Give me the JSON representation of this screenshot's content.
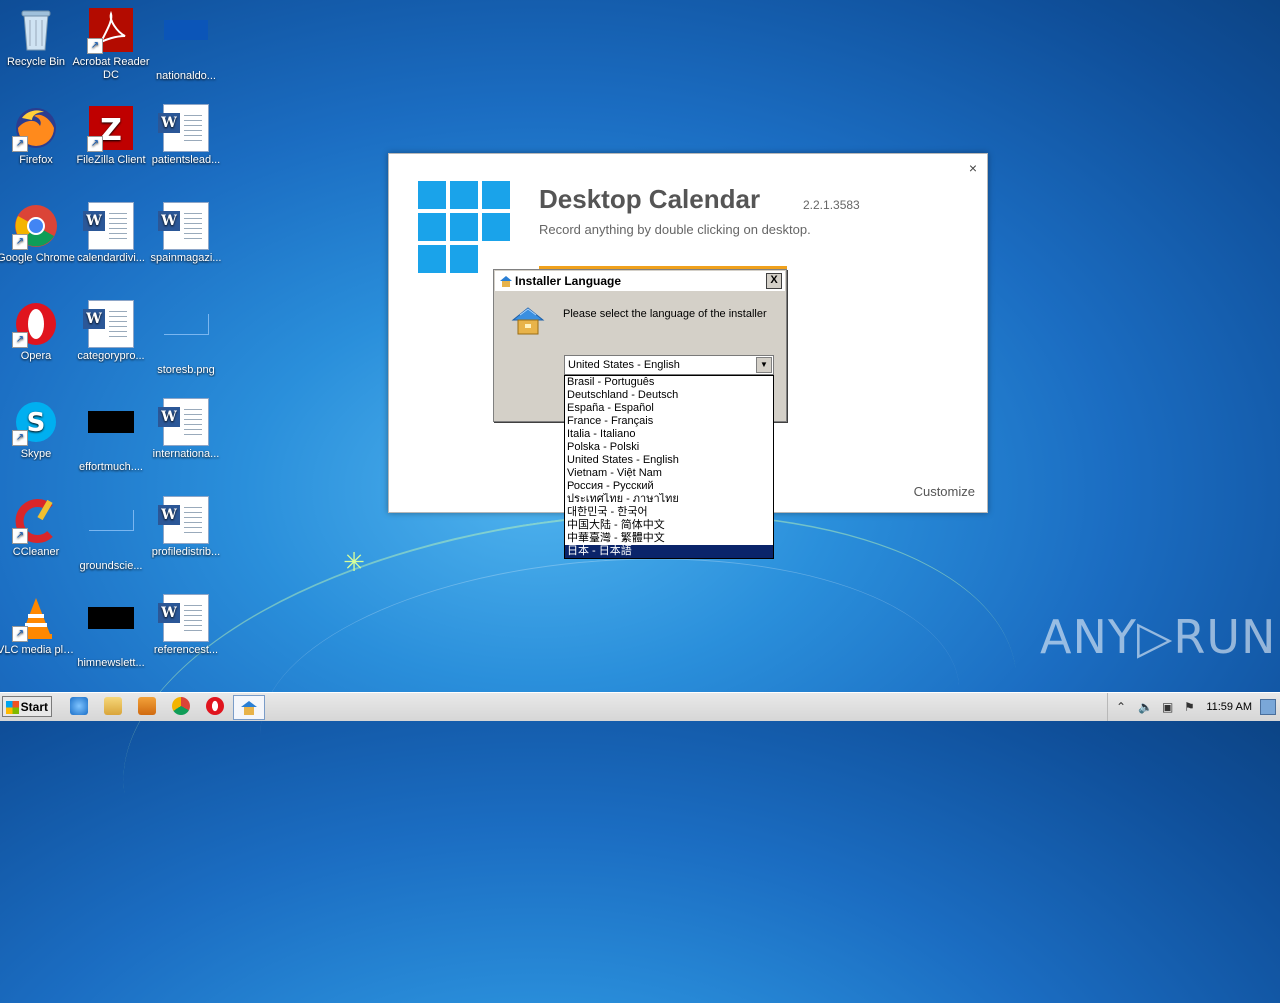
{
  "desktop": {
    "icons": [
      {
        "label": "Recycle Bin",
        "icon": "recycle-bin-icon"
      },
      {
        "label": "Acrobat Reader DC",
        "icon": "acrobat-icon"
      },
      {
        "label": "nationaldo...",
        "icon": "file-icon"
      },
      {
        "label": "Firefox",
        "icon": "firefox-icon"
      },
      {
        "label": "FileZilla Client",
        "icon": "filezilla-icon"
      },
      {
        "label": "patientslead...",
        "icon": "word-doc-icon"
      },
      {
        "label": "Google Chrome",
        "icon": "chrome-icon"
      },
      {
        "label": "calendardivi...",
        "icon": "word-doc-icon"
      },
      {
        "label": "spainmagazi...",
        "icon": "word-doc-icon"
      },
      {
        "label": "Opera",
        "icon": "opera-icon"
      },
      {
        "label": "categorypro...",
        "icon": "word-doc-icon"
      },
      {
        "label": "storesb.png",
        "icon": "image-file-icon"
      },
      {
        "label": "Skype",
        "icon": "skype-icon"
      },
      {
        "label": "effortmuch....",
        "icon": "file-icon"
      },
      {
        "label": "internationa...",
        "icon": "word-doc-icon"
      },
      {
        "label": "CCleaner",
        "icon": "ccleaner-icon"
      },
      {
        "label": "groundscie...",
        "icon": "file-icon"
      },
      {
        "label": "profiledistrib...",
        "icon": "word-doc-icon"
      },
      {
        "label": "VLC media player",
        "icon": "vlc-icon"
      },
      {
        "label": "himnewslett...",
        "icon": "file-icon"
      },
      {
        "label": "referencest...",
        "icon": "word-doc-icon"
      }
    ]
  },
  "installer": {
    "app_name": "Desktop Calendar",
    "version": "2.2.1.3583",
    "subtitle": "Record anything by double clicking on desktop.",
    "close": "×",
    "customize": "Customize"
  },
  "lang_dialog": {
    "title": "Installer Language",
    "close": "X",
    "prompt": "Please select the language of the installer",
    "selected": "United States - English",
    "options": [
      "Brasil - Português",
      "Deutschland - Deutsch",
      "España - Español",
      "France - Français",
      "Italia - Italiano",
      "Polska - Polski",
      "United States - English",
      "Vietnam - Việt Nam",
      "Россия - Русский",
      "ประเทศไทย - ภาษาไทย",
      "대한민국 - 한국어",
      "中国大陆 - 简体中文",
      "中華臺灣 - 繁體中文",
      "日本 - 日本語"
    ],
    "highlighted_index": 13
  },
  "watermark": "ANY▷RUN",
  "taskbar": {
    "start_label": "Start",
    "clock": "11:59 AM"
  },
  "colors": {
    "tile_blue": "#1aa3ea",
    "progress_orange": "#f0a11c",
    "selection_navy": "#0a246a"
  }
}
